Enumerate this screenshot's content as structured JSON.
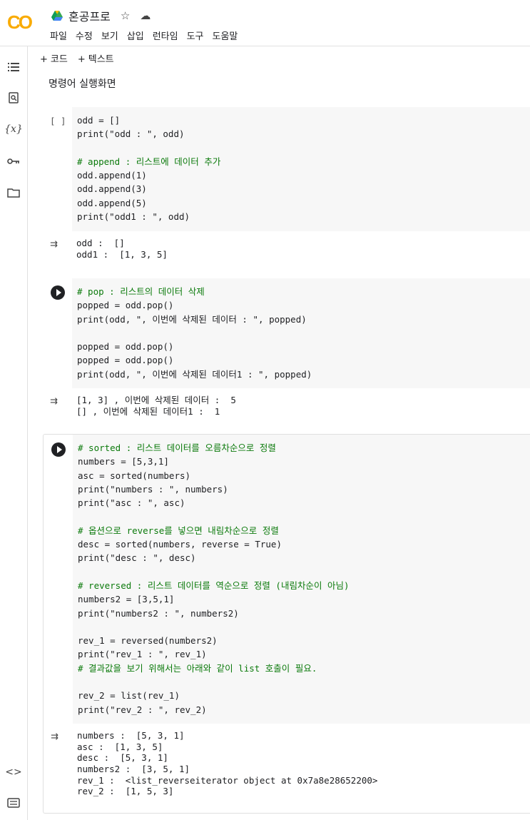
{
  "app": {
    "logo": "CO",
    "title": "혼공프로",
    "menu": [
      "파일",
      "수정",
      "보기",
      "삽입",
      "런타임",
      "도구",
      "도움말"
    ]
  },
  "toolbar": {
    "add_code": "코드",
    "add_text": "텍스트"
  },
  "text_cell": "명령어 실행화면",
  "cells": [
    {
      "run_label": "[ ]",
      "code": [
        "odd = []",
        "print(\"odd : \", odd)",
        "",
        "# append : 리스트에 데이터 추가",
        "odd.append(1)",
        "odd.append(3)",
        "odd.append(5)",
        "print(\"odd1 : \", odd)"
      ],
      "output": [
        "odd :  []",
        "odd1 :  [1, 3, 5]"
      ]
    },
    {
      "run_label": "",
      "code": [
        "# pop : 리스트의 데이터 삭제",
        "popped = odd.pop()",
        "print(odd, \", 이번에 삭제된 데이터 : \", popped)",
        "",
        "popped = odd.pop()",
        "popped = odd.pop()",
        "print(odd, \", 이번에 삭제된 데이터1 : \", popped)"
      ],
      "output": [
        "[1, 3] , 이번에 삭제된 데이터 :  5",
        "[] , 이번에 삭제된 데이터1 :  1"
      ]
    },
    {
      "run_label": "",
      "code": [
        "# sorted : 리스트 데이터를 오름차순으로 정렬",
        "numbers = [5,3,1]",
        "asc = sorted(numbers)",
        "print(\"numbers : \", numbers)",
        "print(\"asc : \", asc)",
        "",
        "# 옵션으로 reverse를 넣으면 내림차순으로 정렬",
        "desc = sorted(numbers, reverse = True)",
        "print(\"desc : \", desc)",
        "",
        "# reversed : 리스트 데이터를 역순으로 정렬 (내림차순이 아님)",
        "numbers2 = [3,5,1]",
        "print(\"numbers2 : \", numbers2)",
        "",
        "rev_1 = reversed(numbers2)",
        "print(\"rev_1 : \", rev_1)",
        "# 결과값을 보기 위해서는 아래와 같이 list 호출이 필요.",
        "",
        "rev_2 = list(rev_1)",
        "print(\"rev_2 : \", rev_2)"
      ],
      "output": [
        "numbers :  [5, 3, 1]",
        "asc :  [1, 3, 5]",
        "desc :  [5, 3, 1]",
        "numbers2 :  [3, 5, 1]",
        "rev_1 :  <list_reverseiterator object at 0x7a8e28652200>",
        "rev_2 :  [1, 5, 3]"
      ]
    }
  ]
}
